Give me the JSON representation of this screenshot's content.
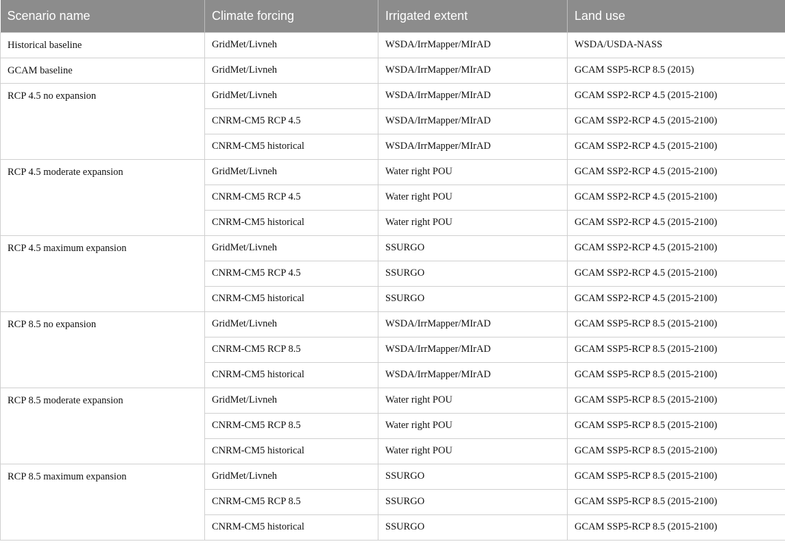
{
  "table": {
    "headers": [
      "Scenario name",
      "Climate forcing",
      "Irrigated extent",
      "Land use"
    ],
    "groups": [
      {
        "scenario": "Historical baseline",
        "rows": [
          {
            "climate": "GridMet/Livneh",
            "extent": "WSDA/IrrMapper/MIrAD",
            "land_use": "WSDA/USDA-NASS"
          }
        ]
      },
      {
        "scenario": "GCAM baseline",
        "rows": [
          {
            "climate": "GridMet/Livneh",
            "extent": "WSDA/IrrMapper/MIrAD",
            "land_use": "GCAM SSP5-RCP 8.5 (2015)"
          }
        ]
      },
      {
        "scenario": "RCP 4.5 no expansion",
        "rows": [
          {
            "climate": "GridMet/Livneh",
            "extent": "WSDA/IrrMapper/MIrAD",
            "land_use": "GCAM SSP2-RCP 4.5 (2015-2100)"
          },
          {
            "climate": "CNRM-CM5 RCP 4.5",
            "extent": "WSDA/IrrMapper/MIrAD",
            "land_use": "GCAM SSP2-RCP 4.5 (2015-2100)"
          },
          {
            "climate": "CNRM-CM5 historical",
            "extent": "WSDA/IrrMapper/MIrAD",
            "land_use": "GCAM SSP2-RCP 4.5 (2015-2100)"
          }
        ]
      },
      {
        "scenario": "RCP 4.5 moderate expansion",
        "rows": [
          {
            "climate": "GridMet/Livneh",
            "extent": "Water right POU",
            "land_use": "GCAM SSP2-RCP 4.5 (2015-2100)"
          },
          {
            "climate": "CNRM-CM5 RCP 4.5",
            "extent": "Water right POU",
            "land_use": "GCAM SSP2-RCP 4.5 (2015-2100)"
          },
          {
            "climate": "CNRM-CM5 historical",
            "extent": "Water right POU",
            "land_use": "GCAM SSP2-RCP 4.5 (2015-2100)"
          }
        ]
      },
      {
        "scenario": "RCP 4.5 maximum expansion",
        "rows": [
          {
            "climate": "GridMet/Livneh",
            "extent": "SSURGO",
            "land_use": "GCAM SSP2-RCP 4.5 (2015-2100)"
          },
          {
            "climate": "CNRM-CM5 RCP 4.5",
            "extent": "SSURGO",
            "land_use": "GCAM SSP2-RCP 4.5 (2015-2100)"
          },
          {
            "climate": "CNRM-CM5 historical",
            "extent": "SSURGO",
            "land_use": "GCAM SSP2-RCP 4.5 (2015-2100)"
          }
        ]
      },
      {
        "scenario": "RCP 8.5 no expansion",
        "rows": [
          {
            "climate": "GridMet/Livneh",
            "extent": "WSDA/IrrMapper/MIrAD",
            "land_use": "GCAM SSP5-RCP 8.5 (2015-2100)"
          },
          {
            "climate": "CNRM-CM5 RCP 8.5",
            "extent": "WSDA/IrrMapper/MIrAD",
            "land_use": "GCAM SSP5-RCP 8.5 (2015-2100)"
          },
          {
            "climate": "CNRM-CM5 historical",
            "extent": "WSDA/IrrMapper/MIrAD",
            "land_use": "GCAM SSP5-RCP 8.5 (2015-2100)"
          }
        ]
      },
      {
        "scenario": "RCP 8.5 moderate expansion",
        "rows": [
          {
            "climate": "GridMet/Livneh",
            "extent": "Water right POU",
            "land_use": "GCAM SSP5-RCP 8.5 (2015-2100)"
          },
          {
            "climate": "CNRM-CM5 RCP 8.5",
            "extent": "Water right POU",
            "land_use": "GCAM SSP5-RCP 8.5 (2015-2100)"
          },
          {
            "climate": "CNRM-CM5 historical",
            "extent": "Water right POU",
            "land_use": "GCAM SSP5-RCP 8.5 (2015-2100)"
          }
        ]
      },
      {
        "scenario": "RCP 8.5 maximum expansion",
        "rows": [
          {
            "climate": "GridMet/Livneh",
            "extent": "SSURGO",
            "land_use": "GCAM SSP5-RCP 8.5 (2015-2100)"
          },
          {
            "climate": "CNRM-CM5 RCP 8.5",
            "extent": "SSURGO",
            "land_use": "GCAM SSP5-RCP 8.5 (2015-2100)"
          },
          {
            "climate": "CNRM-CM5 historical",
            "extent": "SSURGO",
            "land_use": "GCAM SSP5-RCP 8.5 (2015-2100)"
          }
        ]
      }
    ]
  }
}
